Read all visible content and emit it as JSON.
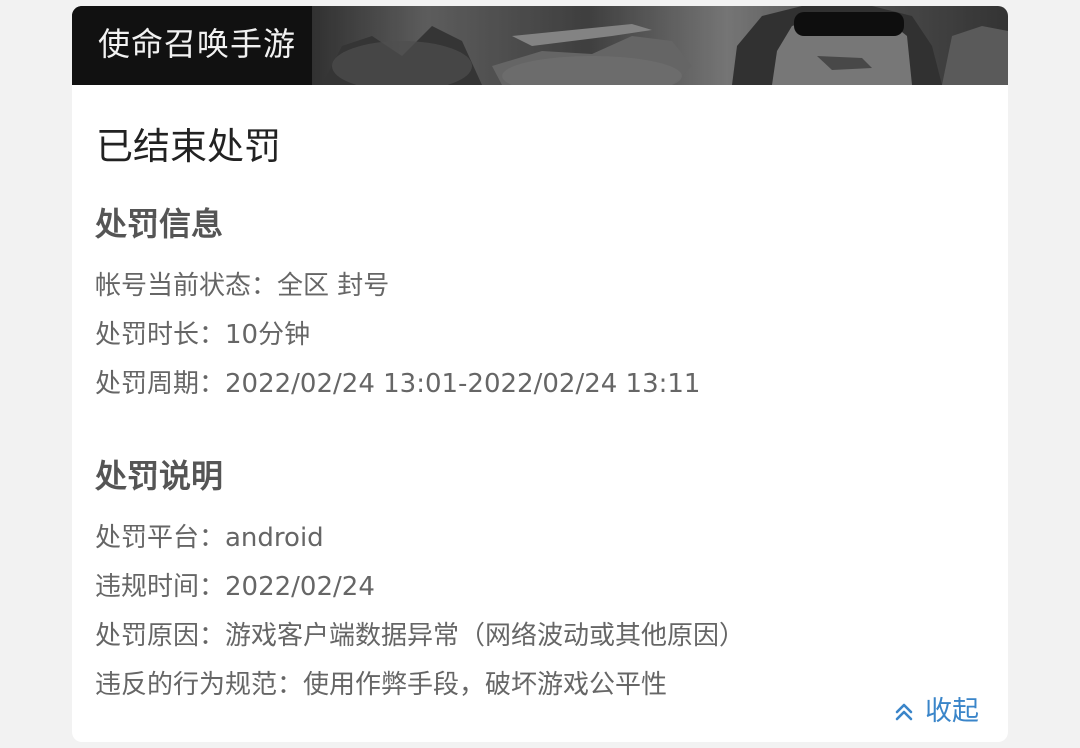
{
  "banner": {
    "game_title": "使命召唤手游"
  },
  "status": {
    "title": "已结束处罚"
  },
  "penalty_info": {
    "heading": "处罚信息",
    "lines": [
      "帐号当前状态：全区 封号",
      "处罚时长：10分钟",
      "处罚周期：2022/02/24 13:01-2022/02/24 13:11"
    ]
  },
  "penalty_explanation": {
    "heading": "处罚说明",
    "lines": [
      "处罚平台：android",
      "违规时间：2022/02/24",
      "处罚原因：游戏客户端数据异常（网络波动或其他原因）",
      "违反的行为规范：使用作弊手段，破坏游戏公平性"
    ]
  },
  "actions": {
    "collapse_label": "收起"
  },
  "colors": {
    "link": "#3a85c9",
    "heading": "#555555",
    "body_text": "#666666",
    "title": "#222222"
  },
  "icons": {
    "collapse": "double-chevron-up-icon"
  }
}
